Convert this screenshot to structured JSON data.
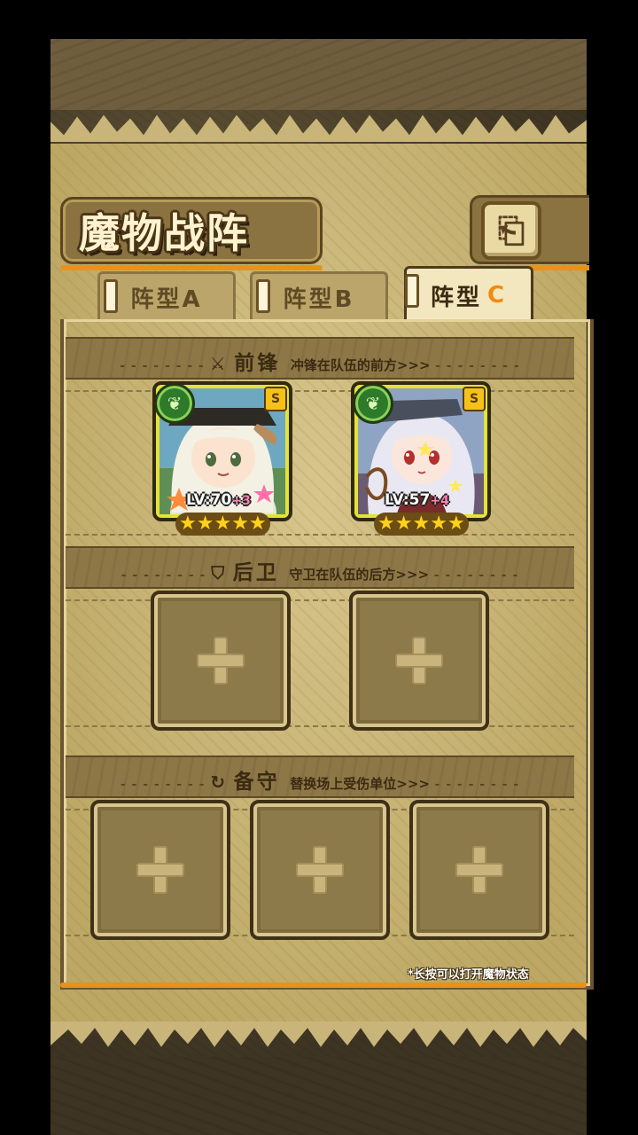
{
  "header": {
    "title": "魔物战阵",
    "back_icon": "⎗"
  },
  "tabs": [
    {
      "label": "阵型A",
      "active": false
    },
    {
      "label": "阵型B",
      "active": false
    },
    {
      "label": "阵型",
      "accent": "C",
      "active": true
    }
  ],
  "sections": {
    "vanguard": {
      "icon": "sword-icon",
      "glyph": "⚔",
      "name": "前锋",
      "desc": "冲锋在队伍的前方>>>"
    },
    "rearguard": {
      "icon": "shield-icon",
      "glyph": "⛉",
      "name": "后卫",
      "desc": "守卫在队伍的后方>>>"
    },
    "reserve": {
      "icon": "swap-icon",
      "glyph": "↻",
      "name": "备守",
      "desc": "替换场上受伤单位>>>"
    }
  },
  "vanguard_units": [
    {
      "level": "LV:70",
      "bonus": "+3",
      "stars": 5,
      "rank": "S",
      "element": "leaf",
      "element_glyph": "❦",
      "hair": "#f2f1e4",
      "accent": "#4d6b3c"
    },
    {
      "level": "LV:57",
      "bonus": "+4",
      "stars": 5,
      "rank": "S",
      "element": "leaf",
      "element_glyph": "❦",
      "hair": "#e9e7f2",
      "accent": "#b23030"
    }
  ],
  "empty_slot_plus": "+",
  "hint": "*长按可以打开魔物状态",
  "colors": {
    "accent_orange": "#e9921a",
    "card_frame": "#e4e23a",
    "element_green": "#2d7a2a",
    "star": "#ffd21a",
    "bonus_pink": "#ff7fb0"
  }
}
